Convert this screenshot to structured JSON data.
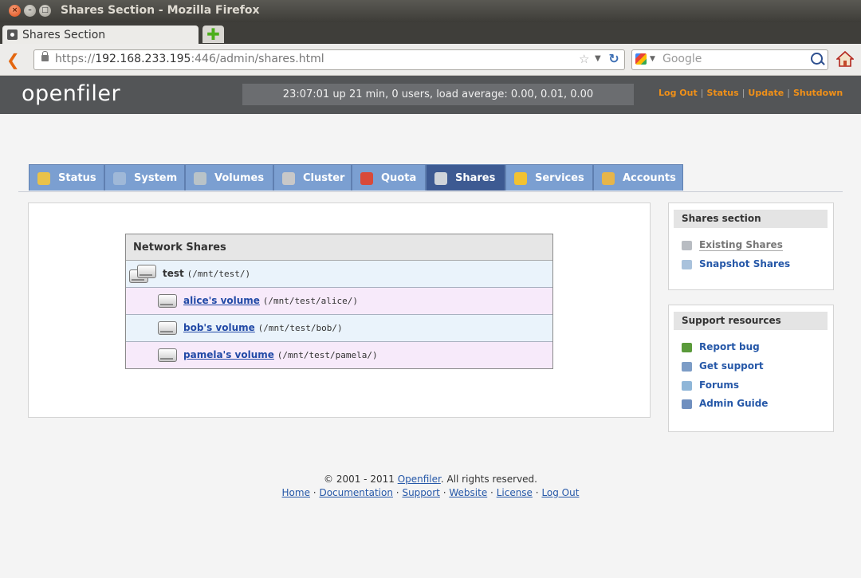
{
  "window": {
    "title": "Shares Section - Mozilla Firefox"
  },
  "browser": {
    "tab_title": "Shares Section",
    "url_prefix": "https://",
    "url_host": "192.168.233.195",
    "url_rest": ":446/admin/shares.html",
    "search_placeholder": "Google"
  },
  "header": {
    "logo": "openfiler",
    "uptime": "23:07:01 up 21 min, 0 users, load average: 0.00, 0.01, 0.00",
    "links": [
      "Log Out",
      "Status",
      "Update",
      "Shutdown"
    ]
  },
  "tabs": [
    {
      "label": "Status",
      "icon": "status-icon",
      "color": "#e9c24a"
    },
    {
      "label": "System",
      "icon": "system-icon",
      "color": "#9fb8d8"
    },
    {
      "label": "Volumes",
      "icon": "volumes-icon",
      "color": "#b9c3c8"
    },
    {
      "label": "Cluster",
      "icon": "cluster-icon",
      "color": "#c8c8c8"
    },
    {
      "label": "Quota",
      "icon": "quota-icon",
      "color": "#d94a3a"
    },
    {
      "label": "Shares",
      "icon": "shares-icon",
      "color": "#cfd4da",
      "active": true
    },
    {
      "label": "Services",
      "icon": "services-icon",
      "color": "#f2c232"
    },
    {
      "label": "Accounts",
      "icon": "accounts-icon",
      "color": "#e6b54a"
    }
  ],
  "shares": {
    "heading": "Network Shares",
    "root": {
      "name": "test",
      "path": "(/mnt/test/)"
    },
    "volumes": [
      {
        "name": "alice's volume",
        "path": "(/mnt/test/alice/)"
      },
      {
        "name": "bob's volume",
        "path": "(/mnt/test/bob/)"
      },
      {
        "name": "pamela's volume",
        "path": "(/mnt/test/pamela/)"
      }
    ]
  },
  "sidebar": {
    "shares_section": {
      "heading": "Shares section",
      "items": [
        {
          "label": "Existing Shares",
          "current": true
        },
        {
          "label": "Snapshot Shares"
        }
      ]
    },
    "support": {
      "heading": "Support resources",
      "items": [
        {
          "label": "Report bug"
        },
        {
          "label": "Get support"
        },
        {
          "label": "Forums"
        },
        {
          "label": "Admin Guide"
        }
      ]
    }
  },
  "footer": {
    "copyright_pre": "© 2001 - 2011 ",
    "copyright_link": "Openfiler",
    "copyright_post": ". All rights reserved.",
    "links": [
      "Home",
      "Documentation",
      "Support",
      "Website",
      "License",
      "Log Out"
    ],
    "separator": "·"
  }
}
